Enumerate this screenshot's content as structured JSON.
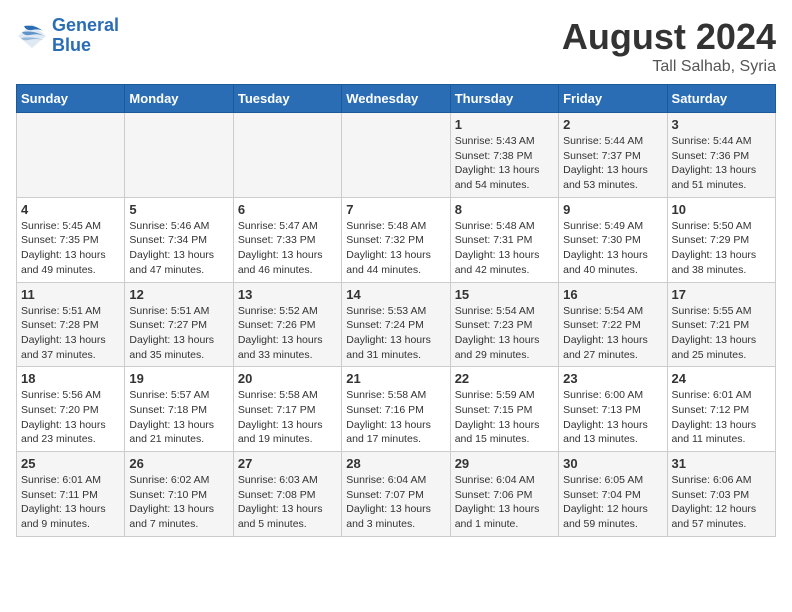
{
  "header": {
    "logo_line1": "General",
    "logo_line2": "Blue",
    "month_title": "August 2024",
    "location": "Tall Salhab, Syria"
  },
  "weekdays": [
    "Sunday",
    "Monday",
    "Tuesday",
    "Wednesday",
    "Thursday",
    "Friday",
    "Saturday"
  ],
  "weeks": [
    [
      {
        "day": "",
        "info": ""
      },
      {
        "day": "",
        "info": ""
      },
      {
        "day": "",
        "info": ""
      },
      {
        "day": "",
        "info": ""
      },
      {
        "day": "1",
        "info": "Sunrise: 5:43 AM\nSunset: 7:38 PM\nDaylight: 13 hours\nand 54 minutes."
      },
      {
        "day": "2",
        "info": "Sunrise: 5:44 AM\nSunset: 7:37 PM\nDaylight: 13 hours\nand 53 minutes."
      },
      {
        "day": "3",
        "info": "Sunrise: 5:44 AM\nSunset: 7:36 PM\nDaylight: 13 hours\nand 51 minutes."
      }
    ],
    [
      {
        "day": "4",
        "info": "Sunrise: 5:45 AM\nSunset: 7:35 PM\nDaylight: 13 hours\nand 49 minutes."
      },
      {
        "day": "5",
        "info": "Sunrise: 5:46 AM\nSunset: 7:34 PM\nDaylight: 13 hours\nand 47 minutes."
      },
      {
        "day": "6",
        "info": "Sunrise: 5:47 AM\nSunset: 7:33 PM\nDaylight: 13 hours\nand 46 minutes."
      },
      {
        "day": "7",
        "info": "Sunrise: 5:48 AM\nSunset: 7:32 PM\nDaylight: 13 hours\nand 44 minutes."
      },
      {
        "day": "8",
        "info": "Sunrise: 5:48 AM\nSunset: 7:31 PM\nDaylight: 13 hours\nand 42 minutes."
      },
      {
        "day": "9",
        "info": "Sunrise: 5:49 AM\nSunset: 7:30 PM\nDaylight: 13 hours\nand 40 minutes."
      },
      {
        "day": "10",
        "info": "Sunrise: 5:50 AM\nSunset: 7:29 PM\nDaylight: 13 hours\nand 38 minutes."
      }
    ],
    [
      {
        "day": "11",
        "info": "Sunrise: 5:51 AM\nSunset: 7:28 PM\nDaylight: 13 hours\nand 37 minutes."
      },
      {
        "day": "12",
        "info": "Sunrise: 5:51 AM\nSunset: 7:27 PM\nDaylight: 13 hours\nand 35 minutes."
      },
      {
        "day": "13",
        "info": "Sunrise: 5:52 AM\nSunset: 7:26 PM\nDaylight: 13 hours\nand 33 minutes."
      },
      {
        "day": "14",
        "info": "Sunrise: 5:53 AM\nSunset: 7:24 PM\nDaylight: 13 hours\nand 31 minutes."
      },
      {
        "day": "15",
        "info": "Sunrise: 5:54 AM\nSunset: 7:23 PM\nDaylight: 13 hours\nand 29 minutes."
      },
      {
        "day": "16",
        "info": "Sunrise: 5:54 AM\nSunset: 7:22 PM\nDaylight: 13 hours\nand 27 minutes."
      },
      {
        "day": "17",
        "info": "Sunrise: 5:55 AM\nSunset: 7:21 PM\nDaylight: 13 hours\nand 25 minutes."
      }
    ],
    [
      {
        "day": "18",
        "info": "Sunrise: 5:56 AM\nSunset: 7:20 PM\nDaylight: 13 hours\nand 23 minutes."
      },
      {
        "day": "19",
        "info": "Sunrise: 5:57 AM\nSunset: 7:18 PM\nDaylight: 13 hours\nand 21 minutes."
      },
      {
        "day": "20",
        "info": "Sunrise: 5:58 AM\nSunset: 7:17 PM\nDaylight: 13 hours\nand 19 minutes."
      },
      {
        "day": "21",
        "info": "Sunrise: 5:58 AM\nSunset: 7:16 PM\nDaylight: 13 hours\nand 17 minutes."
      },
      {
        "day": "22",
        "info": "Sunrise: 5:59 AM\nSunset: 7:15 PM\nDaylight: 13 hours\nand 15 minutes."
      },
      {
        "day": "23",
        "info": "Sunrise: 6:00 AM\nSunset: 7:13 PM\nDaylight: 13 hours\nand 13 minutes."
      },
      {
        "day": "24",
        "info": "Sunrise: 6:01 AM\nSunset: 7:12 PM\nDaylight: 13 hours\nand 11 minutes."
      }
    ],
    [
      {
        "day": "25",
        "info": "Sunrise: 6:01 AM\nSunset: 7:11 PM\nDaylight: 13 hours\nand 9 minutes."
      },
      {
        "day": "26",
        "info": "Sunrise: 6:02 AM\nSunset: 7:10 PM\nDaylight: 13 hours\nand 7 minutes."
      },
      {
        "day": "27",
        "info": "Sunrise: 6:03 AM\nSunset: 7:08 PM\nDaylight: 13 hours\nand 5 minutes."
      },
      {
        "day": "28",
        "info": "Sunrise: 6:04 AM\nSunset: 7:07 PM\nDaylight: 13 hours\nand 3 minutes."
      },
      {
        "day": "29",
        "info": "Sunrise: 6:04 AM\nSunset: 7:06 PM\nDaylight: 13 hours\nand 1 minute."
      },
      {
        "day": "30",
        "info": "Sunrise: 6:05 AM\nSunset: 7:04 PM\nDaylight: 12 hours\nand 59 minutes."
      },
      {
        "day": "31",
        "info": "Sunrise: 6:06 AM\nSunset: 7:03 PM\nDaylight: 12 hours\nand 57 minutes."
      }
    ]
  ]
}
